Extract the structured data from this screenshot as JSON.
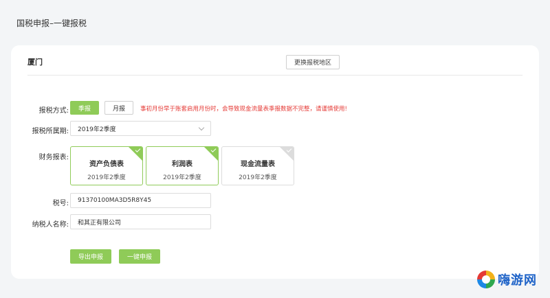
{
  "page": {
    "title": "国税申报–一键报税"
  },
  "panel": {
    "region": "厦门",
    "change_region_label": "更换报税地区"
  },
  "form": {
    "method": {
      "label": "报税方式:",
      "options": [
        "季报",
        "月报"
      ],
      "selected": "季报",
      "warning": "事初月份早于账套启用月份时，会导致现金流量表季报数据不完整，请谨慎使用!"
    },
    "period": {
      "label": "报税所属期:",
      "value": "2019年2季度"
    },
    "reports": {
      "label": "财务报表:",
      "items": [
        {
          "name": "资产负债表",
          "period": "2019年2季度",
          "checked": true
        },
        {
          "name": "利润表",
          "period": "2019年2季度",
          "checked": true
        },
        {
          "name": "现金流量表",
          "period": "2019年2季度",
          "checked": false
        }
      ]
    },
    "tax_id": {
      "label": "税号:",
      "value": "91370100MA3D5R8Y45"
    },
    "taxpayer": {
      "label": "纳税人名称:",
      "value": "和其正有限公司"
    }
  },
  "actions": {
    "export_label": "导出申报",
    "submit_label": "一键申报"
  },
  "watermark": {
    "text": "嗨游网"
  },
  "colors": {
    "accent": "#8fcb58",
    "warning": "#e53935",
    "background": "#f3f5f7"
  }
}
